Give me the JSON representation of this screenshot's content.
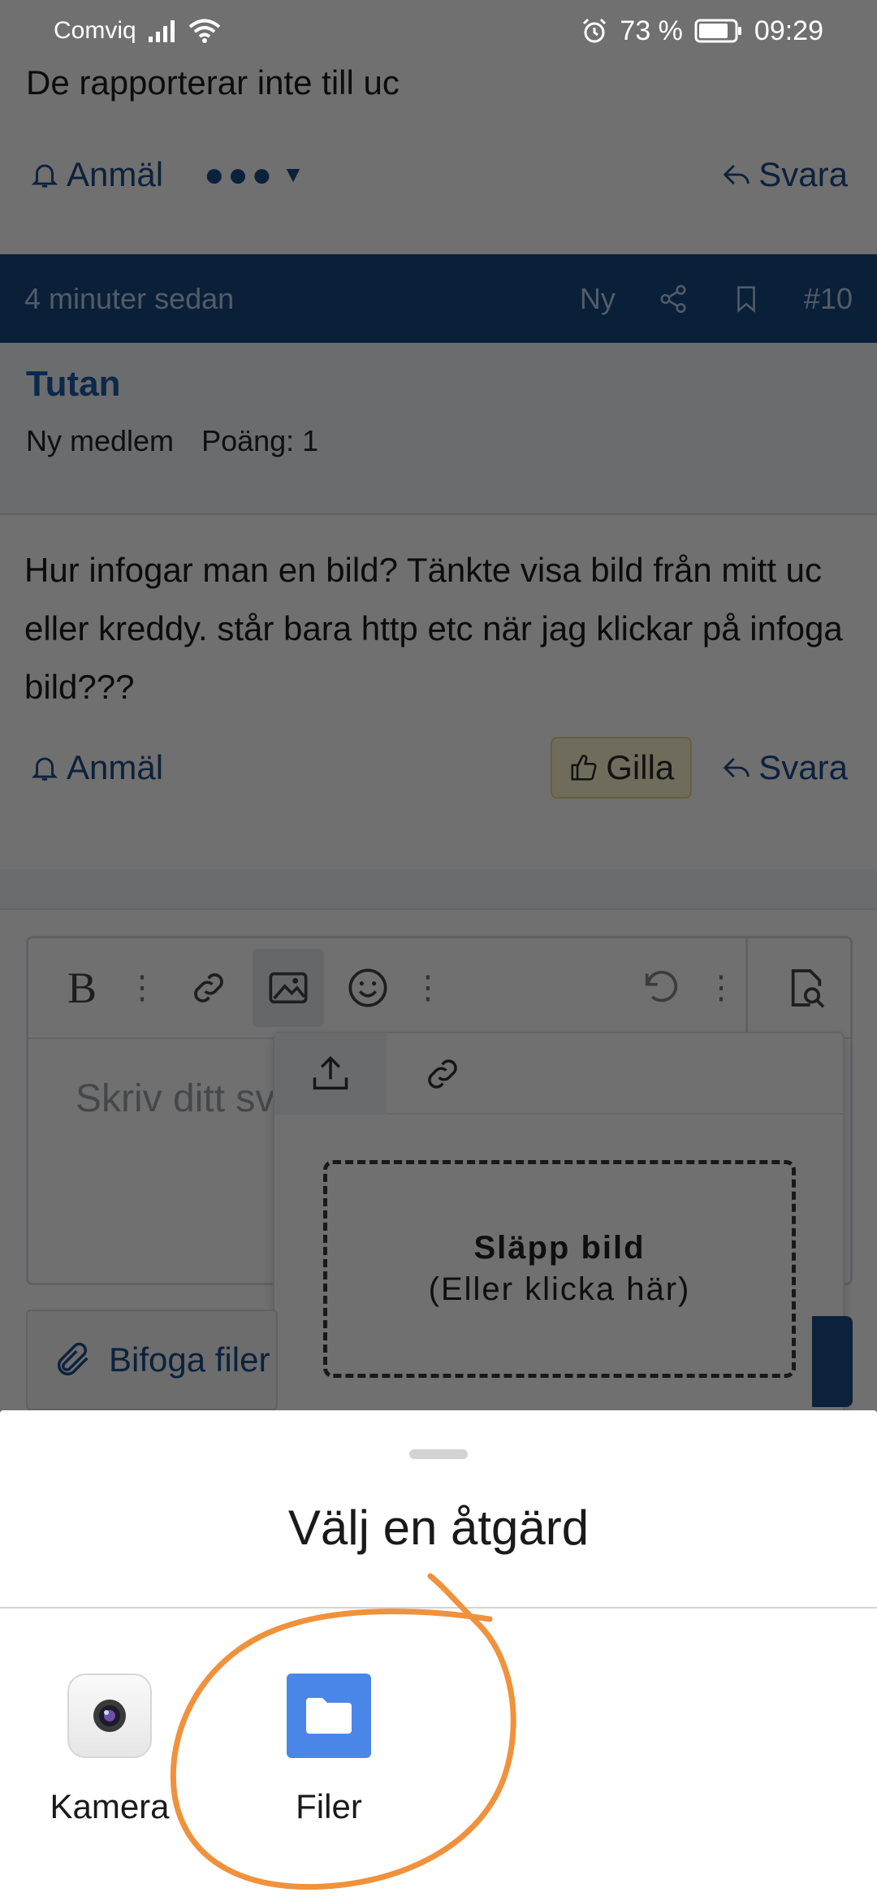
{
  "status_bar": {
    "carrier": "Comviq",
    "battery": "73 %",
    "time": "09:29"
  },
  "previous_post": {
    "text": "De rapporterar inte till uc",
    "report_label": "Anmäl",
    "reply_label": "Svara"
  },
  "post": {
    "time_ago": "4 minuter sedan",
    "new_label": "Ny",
    "number": "#10",
    "username": "Tutan",
    "user_rank": "Ny medlem",
    "user_points": "Poäng: 1",
    "body": "Hur infogar man en bild? Tänkte visa bild från mitt uc eller kreddy. står bara http etc när jag klickar på infoga bild???",
    "report_label": "Anmäl",
    "like_label": "Gilla",
    "reply_label": "Svara"
  },
  "editor": {
    "bold_label": "B",
    "placeholder": "Skriv ditt sv",
    "image_popup": {
      "drop_title": "Släpp bild",
      "drop_subtitle": "(Eller klicka här)"
    },
    "attach_label": "Bifoga filer"
  },
  "chooser": {
    "title": "Välj en åtgärd",
    "options": [
      {
        "label": "Kamera",
        "icon": "camera-icon"
      },
      {
        "label": "Filer",
        "icon": "files-folder-icon"
      }
    ]
  },
  "colors": {
    "forum_blue": "#17477f",
    "link_blue": "#1c4b8a",
    "annotation_orange": "#f0913c"
  }
}
